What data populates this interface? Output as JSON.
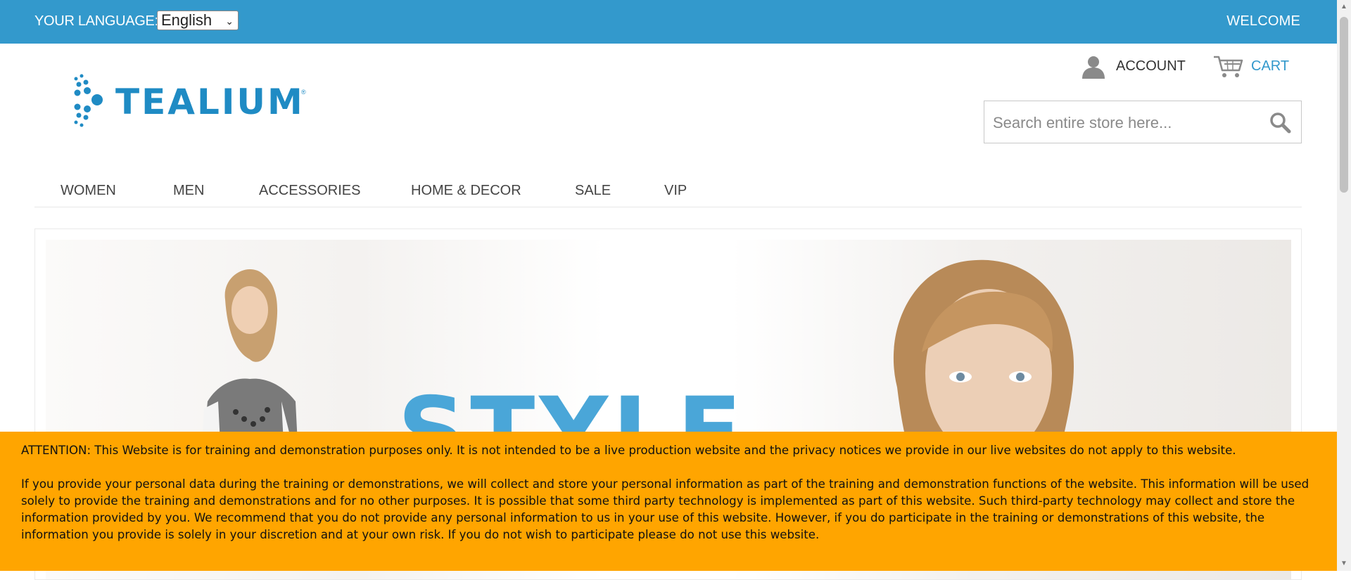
{
  "topbar": {
    "language_label": "YOUR LANGUAGE:",
    "language_selected": "English",
    "welcome": "WELCOME",
    "background": "#3399cc"
  },
  "header": {
    "logo_text": "TEALIUM",
    "logo_tm": "®",
    "account_label": "ACCOUNT",
    "cart_label": "CART",
    "search_placeholder": "Search entire store here...",
    "accent": "#3399cc"
  },
  "nav": {
    "items": [
      {
        "label": "WOMEN"
      },
      {
        "label": "MEN"
      },
      {
        "label": "ACCESSORIES"
      },
      {
        "label": "HOME & DECOR"
      },
      {
        "label": "SALE"
      },
      {
        "label": "VIP"
      }
    ]
  },
  "banner": {
    "headline": "STYLE"
  },
  "notice": {
    "background": "#ffa500",
    "paragraph_1": "ATTENTION: This Website is for training and demonstration purposes only. It is not intended to be a live production website and the privacy notices we provide in our live websites do not apply to this website.",
    "paragraph_2": "If you provide your personal data during the training or demonstrations, we will collect and store your personal information as part of the training and demonstration functions of the website. This information will be used solely to provide the training and demonstrations and for no other purposes. It is possible that some third party technology is implemented as part of this website. Such third-party technology may collect and store the information provided by you. We recommend that you do not provide any personal information to us in your use of this website. However, if you do participate in the training or demonstrations of this website, the information you provide is solely in your discretion and at your own risk. If you do not wish to participate please do not use this website."
  },
  "icons": {
    "account": "user-icon",
    "cart": "cart-icon",
    "search": "search-icon"
  }
}
